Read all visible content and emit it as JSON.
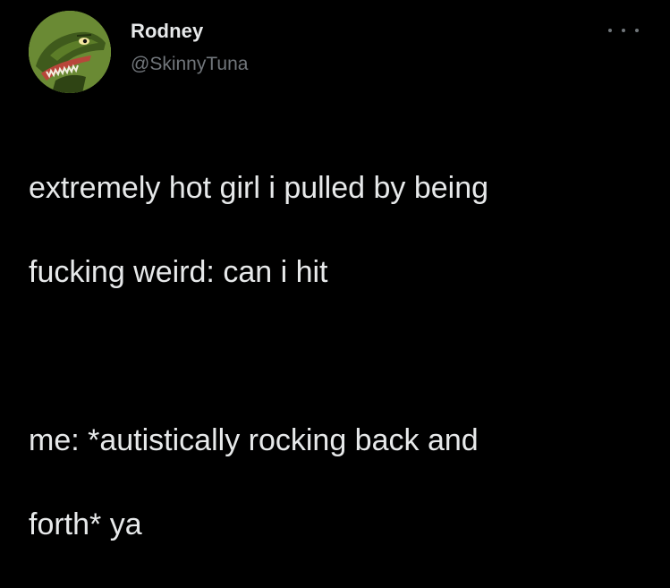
{
  "author": {
    "display_name": "Rodney",
    "handle": "@SkinnyTuna",
    "avatar_icon": "dinosaur-avatar"
  },
  "menu": {
    "icon": "more-options-icon"
  },
  "tweet": {
    "paragraph_1_line_1": "extremely hot girl i pulled by being",
    "paragraph_1_line_2": "fucking weird: can i hit",
    "paragraph_2_line_1": "me: *autistically rocking back and",
    "paragraph_2_line_2": "forth* ya"
  },
  "colors": {
    "background": "#000000",
    "primary_text": "#e7e9ea",
    "secondary_text": "#71767b"
  }
}
